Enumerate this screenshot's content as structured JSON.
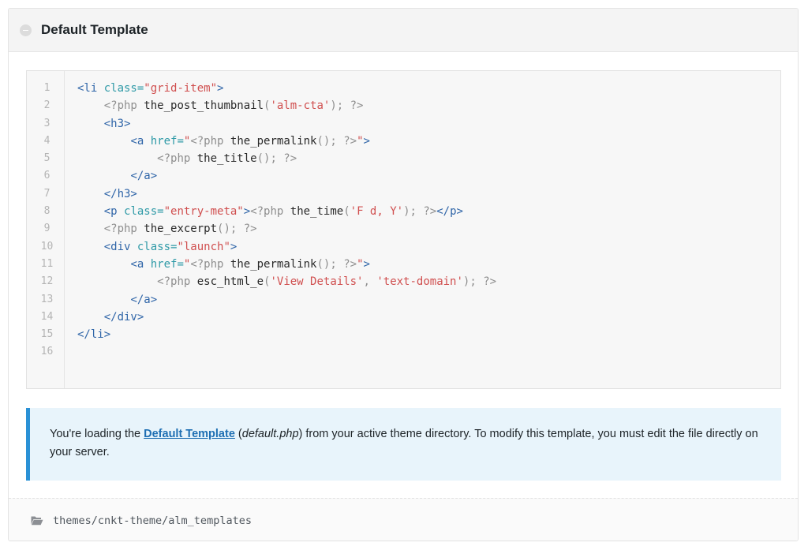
{
  "header": {
    "title": "Default Template",
    "collapse_icon": "minus-circle-icon"
  },
  "editor": {
    "line_numbers": [
      "1",
      "2",
      "3",
      "4",
      "5",
      "6",
      "7",
      "8",
      "9",
      "10",
      "11",
      "12",
      "13",
      "14",
      "15",
      "16"
    ],
    "lines": [
      [
        {
          "t": "tag",
          "v": "<li "
        },
        {
          "t": "attr",
          "v": "class="
        },
        {
          "t": "str",
          "v": "\"grid-item\""
        },
        {
          "t": "tag",
          "v": ">"
        }
      ],
      [
        {
          "t": "plain",
          "v": "    "
        },
        {
          "t": "php",
          "v": "<?php "
        },
        {
          "t": "fn",
          "v": "the_post_thumbnail"
        },
        {
          "t": "php",
          "v": "("
        },
        {
          "t": "str",
          "v": "'alm-cta'"
        },
        {
          "t": "php",
          "v": "); ?>"
        }
      ],
      [
        {
          "t": "plain",
          "v": "    "
        },
        {
          "t": "tag",
          "v": "<h3>"
        }
      ],
      [
        {
          "t": "plain",
          "v": "        "
        },
        {
          "t": "tag",
          "v": "<a "
        },
        {
          "t": "attr",
          "v": "href="
        },
        {
          "t": "str",
          "v": "\""
        },
        {
          "t": "php",
          "v": "<?php "
        },
        {
          "t": "fn",
          "v": "the_permalink"
        },
        {
          "t": "php",
          "v": "(); ?>"
        },
        {
          "t": "str",
          "v": "\""
        },
        {
          "t": "tag",
          "v": ">"
        }
      ],
      [
        {
          "t": "plain",
          "v": "            "
        },
        {
          "t": "php",
          "v": "<?php "
        },
        {
          "t": "fn",
          "v": "the_title"
        },
        {
          "t": "php",
          "v": "(); ?>"
        }
      ],
      [
        {
          "t": "plain",
          "v": "        "
        },
        {
          "t": "tag",
          "v": "</a>"
        }
      ],
      [
        {
          "t": "plain",
          "v": "    "
        },
        {
          "t": "tag",
          "v": "</h3>"
        }
      ],
      [
        {
          "t": "plain",
          "v": "    "
        },
        {
          "t": "tag",
          "v": "<p "
        },
        {
          "t": "attr",
          "v": "class="
        },
        {
          "t": "str",
          "v": "\"entry-meta\""
        },
        {
          "t": "tag",
          "v": ">"
        },
        {
          "t": "php",
          "v": "<?php "
        },
        {
          "t": "fn",
          "v": "the_time"
        },
        {
          "t": "php",
          "v": "("
        },
        {
          "t": "str",
          "v": "'F d, Y'"
        },
        {
          "t": "php",
          "v": "); ?>"
        },
        {
          "t": "tag",
          "v": "</p>"
        }
      ],
      [
        {
          "t": "plain",
          "v": "    "
        },
        {
          "t": "php",
          "v": "<?php "
        },
        {
          "t": "fn",
          "v": "the_excerpt"
        },
        {
          "t": "php",
          "v": "(); ?>"
        }
      ],
      [
        {
          "t": "plain",
          "v": "    "
        },
        {
          "t": "tag",
          "v": "<div "
        },
        {
          "t": "attr",
          "v": "class="
        },
        {
          "t": "str",
          "v": "\"launch\""
        },
        {
          "t": "tag",
          "v": ">"
        }
      ],
      [
        {
          "t": "plain",
          "v": "        "
        },
        {
          "t": "tag",
          "v": "<a "
        },
        {
          "t": "attr",
          "v": "href="
        },
        {
          "t": "str",
          "v": "\""
        },
        {
          "t": "php",
          "v": "<?php "
        },
        {
          "t": "fn",
          "v": "the_permalink"
        },
        {
          "t": "php",
          "v": "(); ?>"
        },
        {
          "t": "str",
          "v": "\""
        },
        {
          "t": "tag",
          "v": ">"
        }
      ],
      [
        {
          "t": "plain",
          "v": "            "
        },
        {
          "t": "php",
          "v": "<?php "
        },
        {
          "t": "fn",
          "v": "esc_html_e"
        },
        {
          "t": "php",
          "v": "("
        },
        {
          "t": "str",
          "v": "'View Details'"
        },
        {
          "t": "php",
          "v": ", "
        },
        {
          "t": "str",
          "v": "'text-domain'"
        },
        {
          "t": "php",
          "v": "); ?>"
        }
      ],
      [
        {
          "t": "plain",
          "v": "        "
        },
        {
          "t": "tag",
          "v": "</a>"
        }
      ],
      [
        {
          "t": "plain",
          "v": "    "
        },
        {
          "t": "tag",
          "v": "</div>"
        }
      ],
      [
        {
          "t": "tag",
          "v": "</li>"
        }
      ],
      []
    ]
  },
  "notice": {
    "prefix": "You're loading the ",
    "link_text": "Default Template",
    "paren_open": " (",
    "filename": "default.php",
    "suffix": ") from your active theme directory. To modify this template, you must edit the file directly on your server."
  },
  "footer": {
    "folder_icon": "folder-open-icon",
    "path": "themes/cnkt-theme/alm_templates"
  }
}
